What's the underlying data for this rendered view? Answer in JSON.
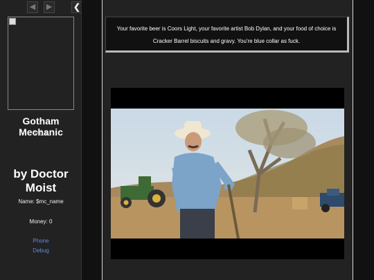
{
  "sidebar": {
    "back_icon": "arrow-left-icon",
    "forward_icon": "arrow-right-icon",
    "collapse_icon": "chevron-left-icon",
    "story_title": "Gotham Mechanic",
    "version": "V 0.1",
    "author": "by Doctor Moist",
    "name_label": "Name: $mc_name",
    "money_label": "Money: 0",
    "links": [
      "Phone",
      "Debug"
    ]
  },
  "passage": {
    "text": "Your favorite beer is Coors Light, your favorite artist Bob Dylan, and your food of choice is Cracker Barrel biscuits and gravy. You're blue collar as fuck."
  },
  "colors": {
    "sidebar_bg": "#222222",
    "link": "#6688dd",
    "page_bg": "#111111"
  }
}
